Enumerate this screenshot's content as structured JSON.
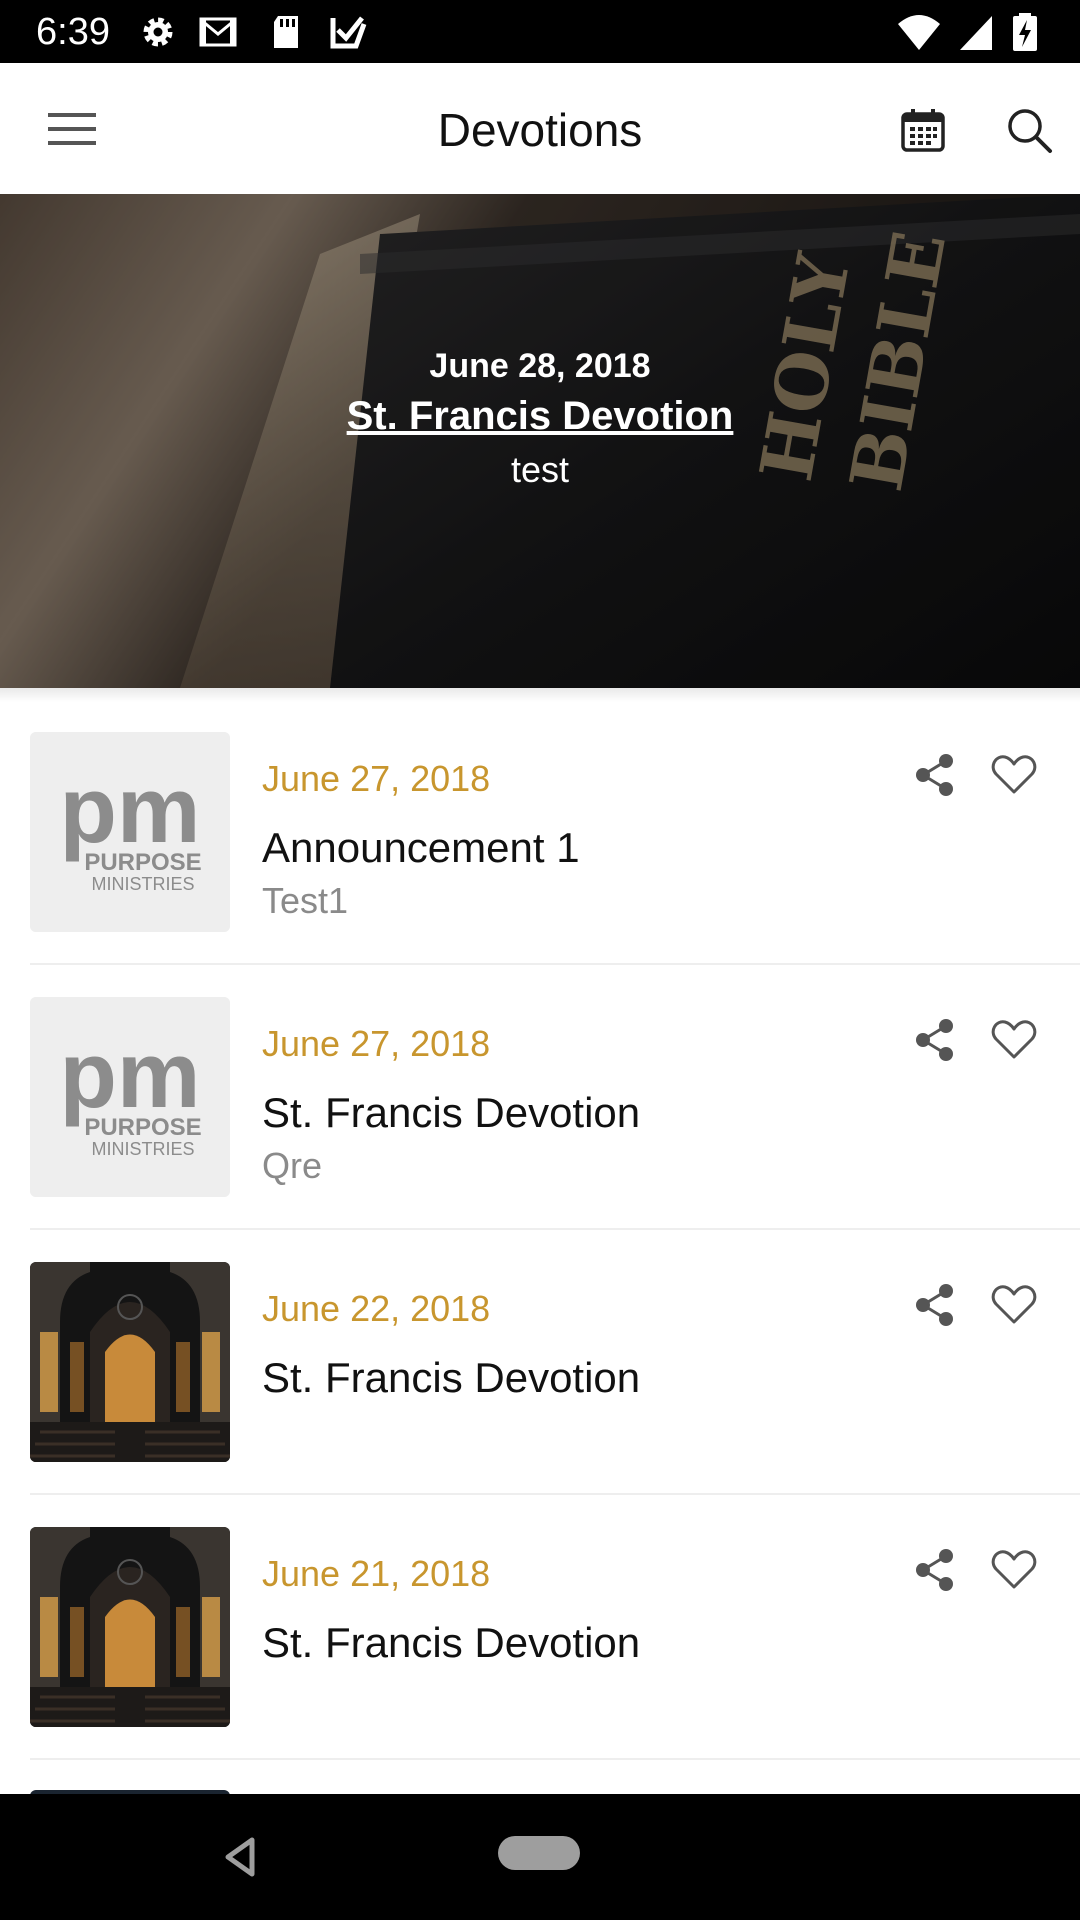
{
  "status_bar": {
    "time": "6:39",
    "left_icons": [
      "gear-icon",
      "gmail-icon",
      "sd-card-icon",
      "task-check-icon"
    ],
    "right_icons": [
      "wifi-icon",
      "cell-signal-icon",
      "battery-charging-icon"
    ]
  },
  "app_bar": {
    "title": "Devotions",
    "icons": [
      "hamburger-menu-icon",
      "calendar-icon",
      "search-icon"
    ]
  },
  "hero": {
    "date": "June 28, 2018",
    "title": "St. Francis Devotion",
    "subtitle": "test",
    "image": "holy-bible-photo"
  },
  "items": [
    {
      "date": "June 27, 2018",
      "title": "Announcement 1",
      "subtitle": "Test1",
      "thumbnail": "purpose-ministries-logo",
      "logo_main": "pm",
      "logo_line1": "PURPOSE",
      "logo_line2": "MINISTRIES"
    },
    {
      "date": "June 27, 2018",
      "title": "St. Francis Devotion",
      "subtitle": "Qre",
      "thumbnail": "purpose-ministries-logo",
      "logo_main": "pm",
      "logo_line1": "PURPOSE",
      "logo_line2": "MINISTRIES"
    },
    {
      "date": "June 22, 2018",
      "title": "St. Francis Devotion",
      "subtitle": "",
      "thumbnail": "church-interior-photo"
    },
    {
      "date": "June 21, 2018",
      "title": "St. Francis Devotion",
      "subtitle": "",
      "thumbnail": "church-interior-photo"
    }
  ],
  "colors": {
    "accent_date": "#c8962e",
    "status_bar": "#000000",
    "nav_bar": "#000000"
  }
}
